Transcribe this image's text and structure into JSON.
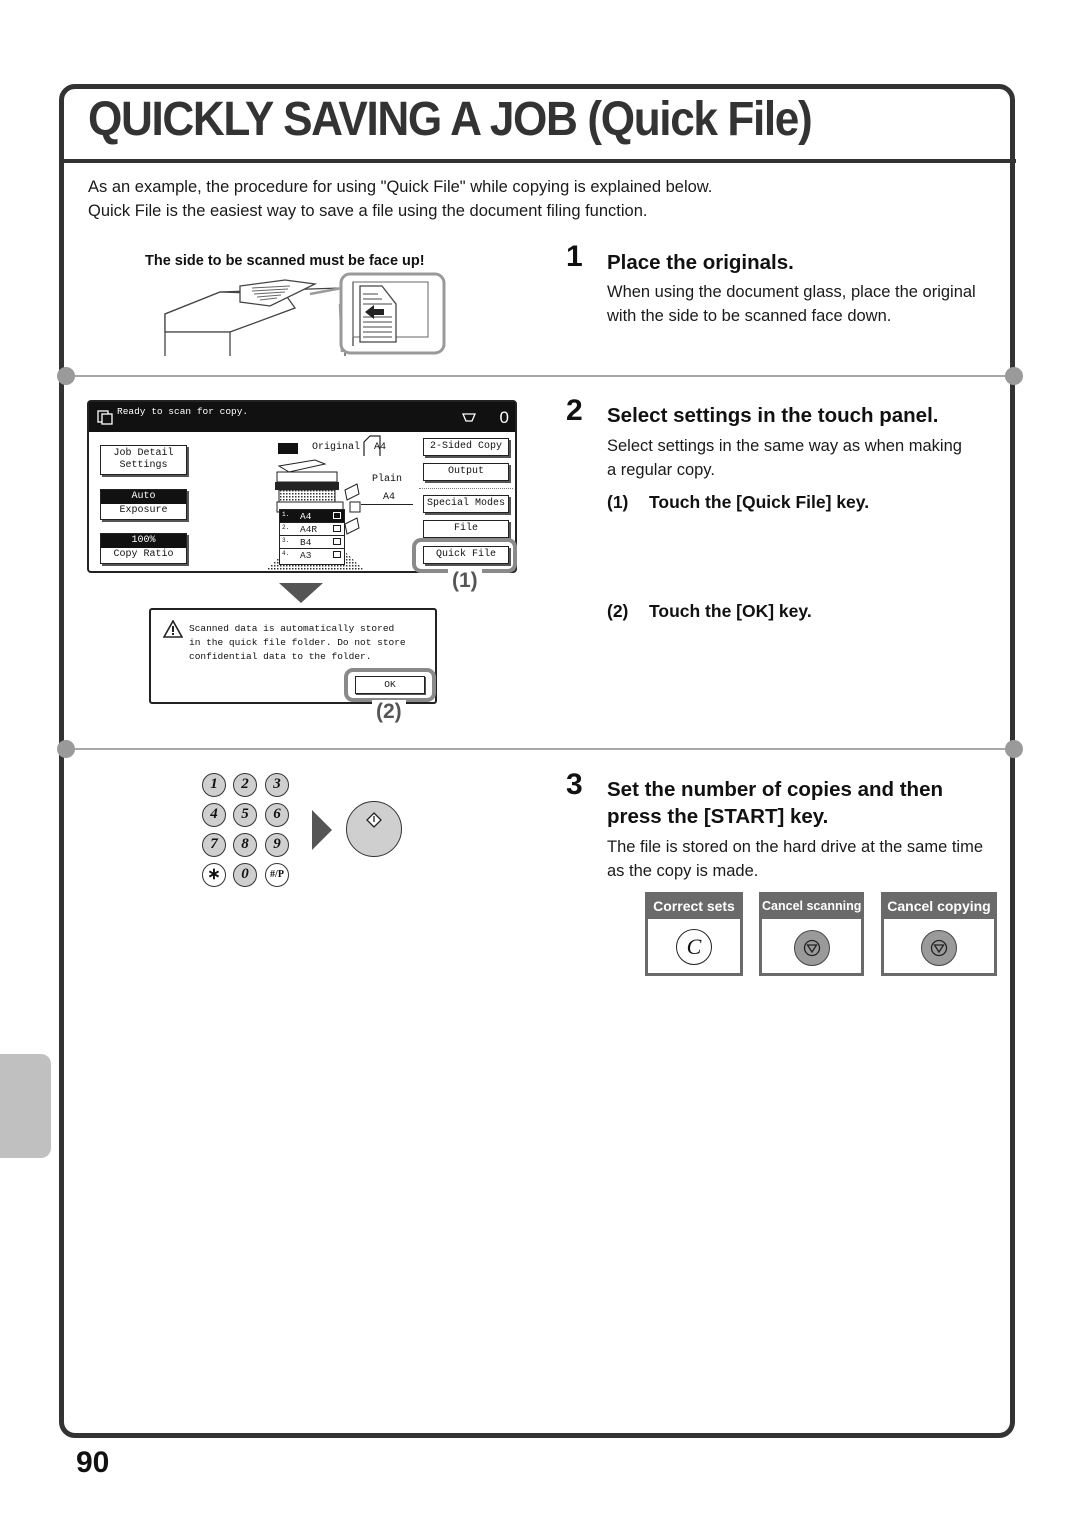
{
  "page": {
    "title": "QUICKLY SAVING A JOB (Quick File)",
    "intro_lines": [
      "As an example, the procedure for using \"Quick File\" while copying is explained below.",
      "Quick File is the easiest way to save a file using the document filing function."
    ],
    "page_number": "90"
  },
  "illustration_1": {
    "caption": "The side to be scanned must be face up!"
  },
  "steps": [
    {
      "number": "1",
      "heading": "Place the originals.",
      "text": "When using the document glass, place the original with the side to be scanned face down."
    },
    {
      "number": "2",
      "heading": "Select settings in the touch panel.",
      "text": "Select settings in the same way as when making a regular copy.",
      "substeps": [
        {
          "number": "(1)",
          "text": "Touch the [Quick File] key."
        },
        {
          "number": "(2)",
          "text": "Touch the [OK] key."
        }
      ]
    },
    {
      "number": "3",
      "heading_lines": [
        "Set the number of copies and then",
        "press the [START] key."
      ],
      "text": "The file is stored on the hard drive at the same time as the copy is made."
    }
  ],
  "touch_panel": {
    "status": "Ready to scan for copy.",
    "copy_count": "0",
    "left_buttons": {
      "job_detail": [
        "Job Detail",
        "Settings"
      ],
      "exposure": {
        "value": "Auto",
        "label": "Exposure"
      },
      "copy_ratio": {
        "value": "100%",
        "label": "Copy Ratio"
      }
    },
    "original_label": "Original",
    "original_size": "A4",
    "paper_type": "Plain",
    "paper_size": "A4",
    "trays": [
      {
        "index": "1.",
        "size": "A4",
        "selected": true
      },
      {
        "index": "2.",
        "size": "A4R",
        "selected": false
      },
      {
        "index": "3.",
        "size": "B4",
        "selected": false
      },
      {
        "index": "4.",
        "size": "A3",
        "selected": false
      }
    ],
    "right_buttons": [
      "2-Sided Copy",
      "Output",
      "Special Modes",
      "File",
      "Quick File"
    ]
  },
  "callouts": {
    "one": "(1)",
    "two": "(2)"
  },
  "dialog": {
    "message": "Scanned data is automatically stored\nin the quick file folder. Do not store\nconfidential data to the folder.",
    "ok_label": "OK"
  },
  "keypad": {
    "keys": [
      "1",
      "2",
      "3",
      "4",
      "5",
      "6",
      "7",
      "8",
      "9",
      "∗",
      "0",
      "#/P"
    ]
  },
  "key_boxes": [
    {
      "label": "Correct sets",
      "icon": "clear-c-icon"
    },
    {
      "label": "Cancel scanning",
      "icon": "stop-icon"
    },
    {
      "label": "Cancel copying",
      "icon": "stop-icon"
    }
  ],
  "colors": {
    "frame": "#333333",
    "divider": "#a8a8a8",
    "key_box_header": "#6a6a6a",
    "side_tab": "#c0c0c0",
    "highlight": "#8a8a8a"
  }
}
